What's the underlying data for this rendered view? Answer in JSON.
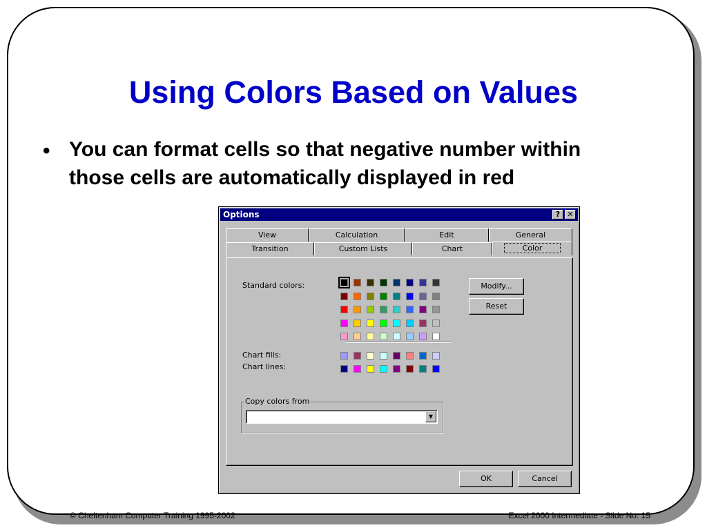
{
  "slide": {
    "title": "Using Colors Based on Values",
    "bullet": "You can format cells so that negative number within those cells are automatically displayed in red",
    "bullet_marker": "•",
    "footer_left": "© Cheltenham Computer Training 1995-2002",
    "footer_right": "Excel 2000 Intermediate - Slide No. 15"
  },
  "dialog": {
    "title": "Options",
    "help_button": "?",
    "close_button": "✕",
    "tabs_row1": [
      "View",
      "Calculation",
      "Edit",
      "General"
    ],
    "tabs_row2": [
      "Transition",
      "Custom Lists",
      "Chart",
      "Color"
    ],
    "active_tab": "Color",
    "labels": {
      "standard_colors": "Standard colors:",
      "chart_fills": "Chart fills:",
      "chart_lines": "Chart lines:",
      "copy_colors_from": "Copy colors from"
    },
    "buttons": {
      "modify": "Modify...",
      "reset": "Reset",
      "ok": "OK",
      "cancel": "Cancel"
    },
    "copy_colors_value": "",
    "standard_colors": [
      [
        "#000000",
        "#993300",
        "#333300",
        "#003300",
        "#003366",
        "#000080",
        "#333399",
        "#333333"
      ],
      [
        "#800000",
        "#FF6600",
        "#808000",
        "#008000",
        "#008080",
        "#0000FF",
        "#666699",
        "#808080"
      ],
      [
        "#FF0000",
        "#FF9900",
        "#99CC00",
        "#339966",
        "#33CCCC",
        "#3366FF",
        "#800080",
        "#969696"
      ],
      [
        "#FF00FF",
        "#FFCC00",
        "#FFFF00",
        "#00FF00",
        "#00FFFF",
        "#00CCFF",
        "#993366",
        "#C0C0C0"
      ],
      [
        "#FF99CC",
        "#FFCC99",
        "#FFFF99",
        "#CCFFCC",
        "#CCFFFF",
        "#99CCFF",
        "#CC99FF",
        "#FFFFFF"
      ]
    ],
    "chart_fills": [
      "#9999FF",
      "#993366",
      "#FFFFCC",
      "#CCFFFF",
      "#660066",
      "#FF8080",
      "#0066CC",
      "#CCCCFF"
    ],
    "chart_lines": [
      "#000080",
      "#FF00FF",
      "#FFFF00",
      "#00FFFF",
      "#800080",
      "#800000",
      "#008080",
      "#0000FF"
    ],
    "selected_color": "#000000"
  }
}
